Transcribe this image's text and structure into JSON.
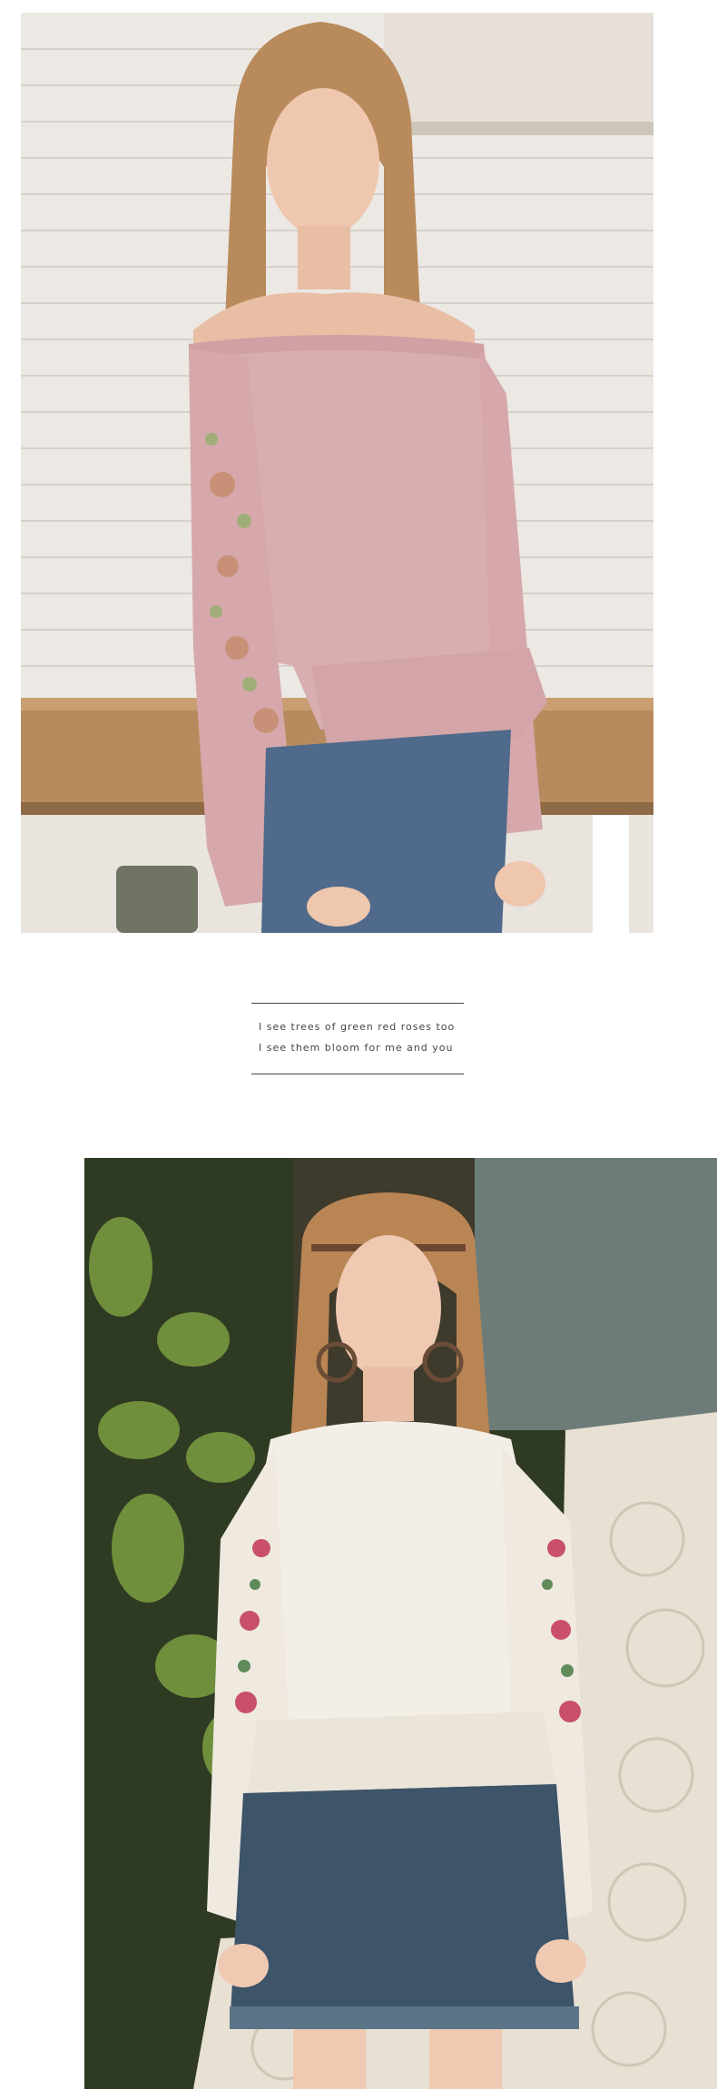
{
  "quote": {
    "line1": "I see trees of green red roses too",
    "line2": "I see them bloom  for me and you"
  },
  "colors": {
    "background": "#ffffff",
    "text": "#444444",
    "rule": "#444444"
  }
}
